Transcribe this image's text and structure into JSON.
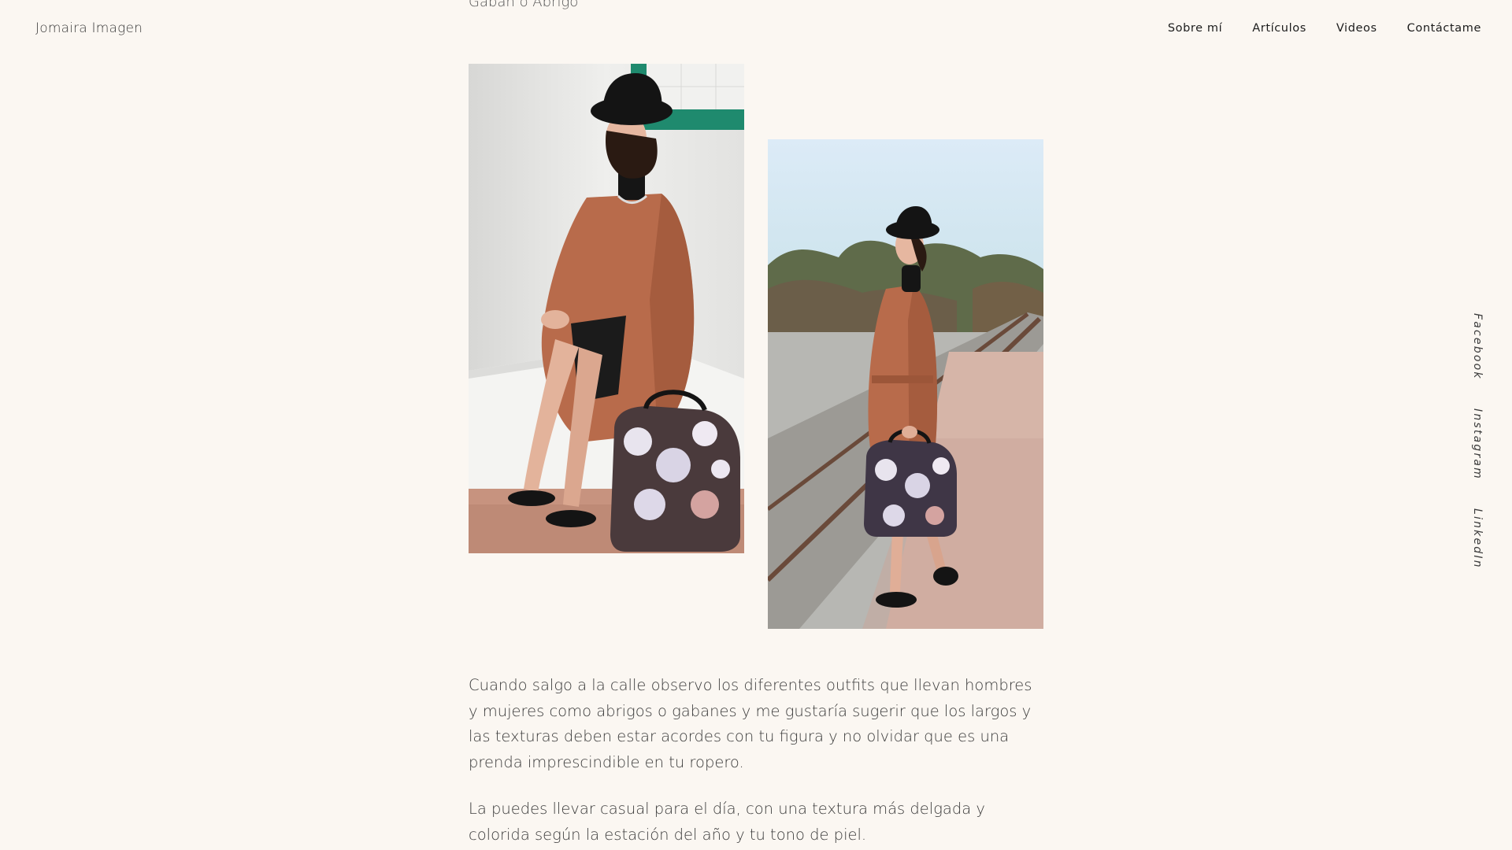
{
  "header": {
    "logo": "Jomaira Imagen",
    "nav": [
      {
        "label": "Sobre mí"
      },
      {
        "label": "Artículos"
      },
      {
        "label": "Videos"
      },
      {
        "label": "Contáctame"
      }
    ]
  },
  "article": {
    "subtitle": "Gabán o Abrigo",
    "paragraphs": [
      "Cuando salgo a la calle observo los diferentes outfits que llevan hombres y mujeres como abrigos o gabanes y me gustaría sugerir que los largos y las texturas deben estar acordes con tu figura y no olvidar que es una prenda imprescindible en tu ropero.",
      "La puedes llevar casual para el día, con una textura más delgada y colorida según la estación del año y tu tono de piel."
    ]
  },
  "social": [
    {
      "label": "Facebook"
    },
    {
      "label": "Instagram"
    },
    {
      "label": "LinkedIn"
    }
  ],
  "colors": {
    "background": "#fbf7f2",
    "coat": "#b86b4b",
    "tile_accent": "#1f8a6e"
  }
}
